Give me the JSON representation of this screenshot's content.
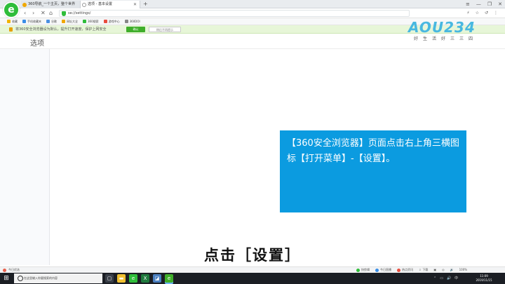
{
  "browser": {
    "tabs": [
      {
        "title": "360导航_一个主页，整个世界"
      },
      {
        "title": "选项 - 基本设置"
      }
    ],
    "new_tab": "+",
    "window_controls": [
      "≡",
      "—",
      "❐",
      "✕"
    ],
    "nav": {
      "back": "‹",
      "forward": "›",
      "close": "✕",
      "home": "⌂"
    },
    "url": "se://settings/",
    "address_tools": [
      "⚡",
      "☆",
      "↺",
      "⋮"
    ]
  },
  "bookmarks": [
    {
      "label": "收藏",
      "color": "#f0b400"
    },
    {
      "label": "手机收藏夹",
      "color": "#3a8ee6"
    },
    {
      "label": "谷歌",
      "color": "#4a90e2"
    },
    {
      "label": "网址大全",
      "color": "#f0a800"
    },
    {
      "label": "360搜索",
      "color": "#2fbd3a"
    },
    {
      "label": "游戏中心",
      "color": "#e84c3d"
    },
    {
      "label": "360DOI",
      "color": "#888888"
    }
  ],
  "notice": {
    "text": "将360安全浏览器设为默认，提升打开速度，保护上网安全",
    "confirm": "确认",
    "later": "稍后不再提示"
  },
  "page": {
    "title": "选项"
  },
  "watermark": {
    "logo": "AOU234",
    "slogan": "好生活好三三四"
  },
  "instruction": {
    "text": "【360安全浏览器】页面点击右上角三横图标【打开菜单】-【设置】。"
  },
  "caption": "点击［设置］",
  "statusbar": {
    "left": "今日优选",
    "right": [
      "快剪辑",
      "今日直播",
      "热点资讯",
      "⇩",
      "下载",
      "▣",
      "◎",
      "🔊",
      "100%"
    ]
  },
  "taskbar": {
    "search_placeholder": "在这里输入你要搜索的内容",
    "apps": [
      {
        "name": "task-view",
        "glyph": "▢",
        "color": "#3a3f48"
      },
      {
        "name": "explorer",
        "glyph": "▬",
        "color": "#f0c030"
      },
      {
        "name": "browser-360",
        "glyph": "e",
        "color": "#2fbd3a"
      },
      {
        "name": "excel",
        "glyph": "X",
        "color": "#1f7a3e"
      },
      {
        "name": "photos",
        "glyph": "◪",
        "color": "#4a7fc0"
      },
      {
        "name": "browser-active",
        "glyph": "e",
        "color": "#3fae2a"
      }
    ],
    "tray": [
      "⌃",
      "▭",
      "🔊",
      "中"
    ],
    "time": "11:09",
    "date": "2019/11/15"
  },
  "colors": {
    "instruction_bg": "#0b9be0",
    "notice_bg": "#e7f6d8",
    "accent_green": "#3fae2a"
  }
}
